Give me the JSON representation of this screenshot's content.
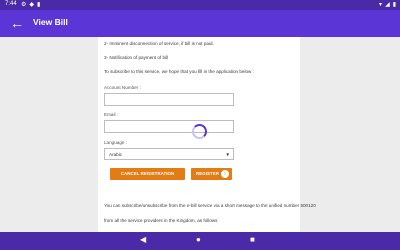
{
  "status_bar": {
    "time": "7:44",
    "left_icons": [
      "settings-icon",
      "shield-icon",
      "sd-card-icon"
    ],
    "right_icons": [
      "wifi-icon",
      "signal-icon",
      "battery-icon"
    ]
  },
  "app_bar": {
    "back_icon": "arrow-back-icon",
    "title": "View Bill"
  },
  "content": {
    "line_imminent": "2- Imminent disconnection of service, if bill is not paid.",
    "line_notification": "3- Notification of payment of bill",
    "line_subscribe": "To subscribe to this service, we hope that you fill in the application below :",
    "account_label": "Account Number :",
    "account_value": "",
    "email_label": "Email :",
    "email_value": "",
    "language_label": "Language :",
    "language_value": "Arabic",
    "cancel_label": "CANCEL REGISTRATION",
    "register_label": "REGISTER",
    "footer_line1": "You can subscribe/unsubscribe from the e-bill service via a short message to the unified number 500120",
    "footer_line2": "from all the service providers in the Kingdom, as follows"
  },
  "nav_bar": {
    "back": "◀",
    "home": "●",
    "recents": "■"
  },
  "colors": {
    "app_bar": "#5b35d5",
    "status_bar": "#4a2aa6",
    "button": "#e47c16"
  }
}
